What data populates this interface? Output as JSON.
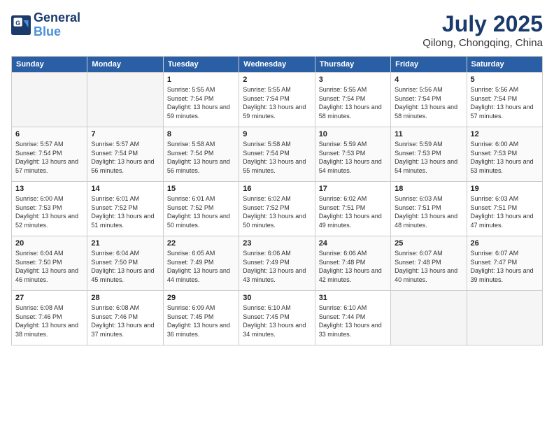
{
  "header": {
    "logo_line1": "General",
    "logo_line2": "Blue",
    "month_year": "July 2025",
    "location": "Qilong, Chongqing, China"
  },
  "weekdays": [
    "Sunday",
    "Monday",
    "Tuesday",
    "Wednesday",
    "Thursday",
    "Friday",
    "Saturday"
  ],
  "weeks": [
    [
      {
        "day": "",
        "empty": true
      },
      {
        "day": "",
        "empty": true
      },
      {
        "day": "1",
        "sunrise": "5:55 AM",
        "sunset": "7:54 PM",
        "daylight": "13 hours and 59 minutes."
      },
      {
        "day": "2",
        "sunrise": "5:55 AM",
        "sunset": "7:54 PM",
        "daylight": "13 hours and 59 minutes."
      },
      {
        "day": "3",
        "sunrise": "5:55 AM",
        "sunset": "7:54 PM",
        "daylight": "13 hours and 58 minutes."
      },
      {
        "day": "4",
        "sunrise": "5:56 AM",
        "sunset": "7:54 PM",
        "daylight": "13 hours and 58 minutes."
      },
      {
        "day": "5",
        "sunrise": "5:56 AM",
        "sunset": "7:54 PM",
        "daylight": "13 hours and 57 minutes."
      }
    ],
    [
      {
        "day": "6",
        "sunrise": "5:57 AM",
        "sunset": "7:54 PM",
        "daylight": "13 hours and 57 minutes."
      },
      {
        "day": "7",
        "sunrise": "5:57 AM",
        "sunset": "7:54 PM",
        "daylight": "13 hours and 56 minutes."
      },
      {
        "day": "8",
        "sunrise": "5:58 AM",
        "sunset": "7:54 PM",
        "daylight": "13 hours and 56 minutes."
      },
      {
        "day": "9",
        "sunrise": "5:58 AM",
        "sunset": "7:54 PM",
        "daylight": "13 hours and 55 minutes."
      },
      {
        "day": "10",
        "sunrise": "5:59 AM",
        "sunset": "7:53 PM",
        "daylight": "13 hours and 54 minutes."
      },
      {
        "day": "11",
        "sunrise": "5:59 AM",
        "sunset": "7:53 PM",
        "daylight": "13 hours and 54 minutes."
      },
      {
        "day": "12",
        "sunrise": "6:00 AM",
        "sunset": "7:53 PM",
        "daylight": "13 hours and 53 minutes."
      }
    ],
    [
      {
        "day": "13",
        "sunrise": "6:00 AM",
        "sunset": "7:53 PM",
        "daylight": "13 hours and 52 minutes."
      },
      {
        "day": "14",
        "sunrise": "6:01 AM",
        "sunset": "7:52 PM",
        "daylight": "13 hours and 51 minutes."
      },
      {
        "day": "15",
        "sunrise": "6:01 AM",
        "sunset": "7:52 PM",
        "daylight": "13 hours and 50 minutes."
      },
      {
        "day": "16",
        "sunrise": "6:02 AM",
        "sunset": "7:52 PM",
        "daylight": "13 hours and 50 minutes."
      },
      {
        "day": "17",
        "sunrise": "6:02 AM",
        "sunset": "7:51 PM",
        "daylight": "13 hours and 49 minutes."
      },
      {
        "day": "18",
        "sunrise": "6:03 AM",
        "sunset": "7:51 PM",
        "daylight": "13 hours and 48 minutes."
      },
      {
        "day": "19",
        "sunrise": "6:03 AM",
        "sunset": "7:51 PM",
        "daylight": "13 hours and 47 minutes."
      }
    ],
    [
      {
        "day": "20",
        "sunrise": "6:04 AM",
        "sunset": "7:50 PM",
        "daylight": "13 hours and 46 minutes."
      },
      {
        "day": "21",
        "sunrise": "6:04 AM",
        "sunset": "7:50 PM",
        "daylight": "13 hours and 45 minutes."
      },
      {
        "day": "22",
        "sunrise": "6:05 AM",
        "sunset": "7:49 PM",
        "daylight": "13 hours and 44 minutes."
      },
      {
        "day": "23",
        "sunrise": "6:06 AM",
        "sunset": "7:49 PM",
        "daylight": "13 hours and 43 minutes."
      },
      {
        "day": "24",
        "sunrise": "6:06 AM",
        "sunset": "7:48 PM",
        "daylight": "13 hours and 42 minutes."
      },
      {
        "day": "25",
        "sunrise": "6:07 AM",
        "sunset": "7:48 PM",
        "daylight": "13 hours and 40 minutes."
      },
      {
        "day": "26",
        "sunrise": "6:07 AM",
        "sunset": "7:47 PM",
        "daylight": "13 hours and 39 minutes."
      }
    ],
    [
      {
        "day": "27",
        "sunrise": "6:08 AM",
        "sunset": "7:46 PM",
        "daylight": "13 hours and 38 minutes."
      },
      {
        "day": "28",
        "sunrise": "6:08 AM",
        "sunset": "7:46 PM",
        "daylight": "13 hours and 37 minutes."
      },
      {
        "day": "29",
        "sunrise": "6:09 AM",
        "sunset": "7:45 PM",
        "daylight": "13 hours and 36 minutes."
      },
      {
        "day": "30",
        "sunrise": "6:10 AM",
        "sunset": "7:45 PM",
        "daylight": "13 hours and 34 minutes."
      },
      {
        "day": "31",
        "sunrise": "6:10 AM",
        "sunset": "7:44 PM",
        "daylight": "13 hours and 33 minutes."
      },
      {
        "day": "",
        "empty": true
      },
      {
        "day": "",
        "empty": true
      }
    ]
  ]
}
